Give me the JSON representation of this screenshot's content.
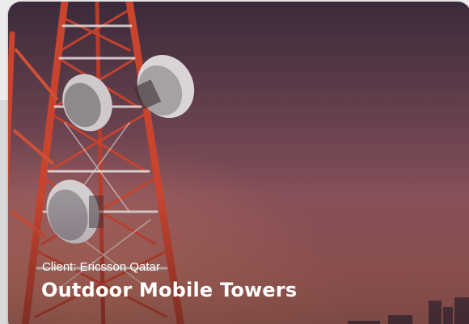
{
  "card": {
    "client_text": "Client: Ericsson Qatar",
    "title": "Outdoor Mobile Towers",
    "image_icon": "telecom-tower-photo"
  },
  "colors": {
    "sky_top": "#3a2a3a",
    "sky_bottom": "#c27565",
    "tower_red": "#c8442e",
    "tower_white": "#e8e2e2",
    "text": "#ffffff"
  }
}
